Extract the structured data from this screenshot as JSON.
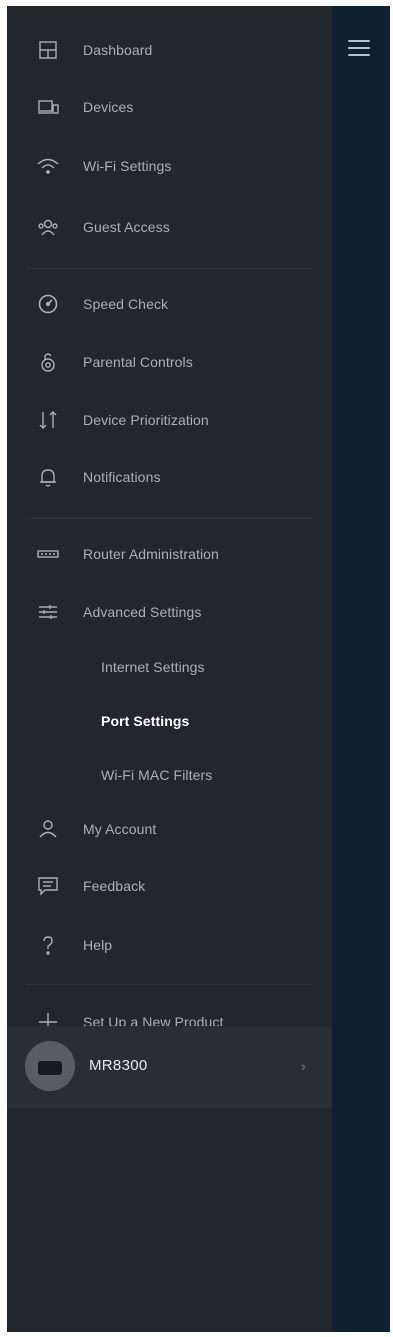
{
  "menu": {
    "items": [
      {
        "label": "Dashboard",
        "icon": "dashboard-icon"
      },
      {
        "label": "Devices",
        "icon": "devices-icon"
      },
      {
        "label": "Wi-Fi Settings",
        "icon": "wifi-icon"
      },
      {
        "label": "Guest Access",
        "icon": "guest-access-icon"
      },
      {
        "label": "Speed Check",
        "icon": "speedometer-icon"
      },
      {
        "label": "Parental Controls",
        "icon": "lock-icon"
      },
      {
        "label": "Device Prioritization",
        "icon": "priority-arrows-icon"
      },
      {
        "label": "Notifications",
        "icon": "bell-icon"
      },
      {
        "label": "Router Administration",
        "icon": "router-icon"
      },
      {
        "label": "Advanced Settings",
        "icon": "sliders-icon"
      },
      {
        "label": "Internet Settings"
      },
      {
        "label": "Port Settings",
        "active": true
      },
      {
        "label": "Wi-Fi MAC Filters"
      },
      {
        "label": "My Account",
        "icon": "user-icon"
      },
      {
        "label": "Feedback",
        "icon": "chat-icon"
      },
      {
        "label": "Help",
        "icon": "question-icon"
      },
      {
        "label": "Set Up a New Product",
        "icon": "plus-icon"
      }
    ]
  },
  "device": {
    "name": "MR8300",
    "chevron": "›"
  },
  "colors": {
    "drawer": "#22262d",
    "backdrop": "#0f2030",
    "text": "#a9b0b9",
    "active": "#ffffff"
  }
}
